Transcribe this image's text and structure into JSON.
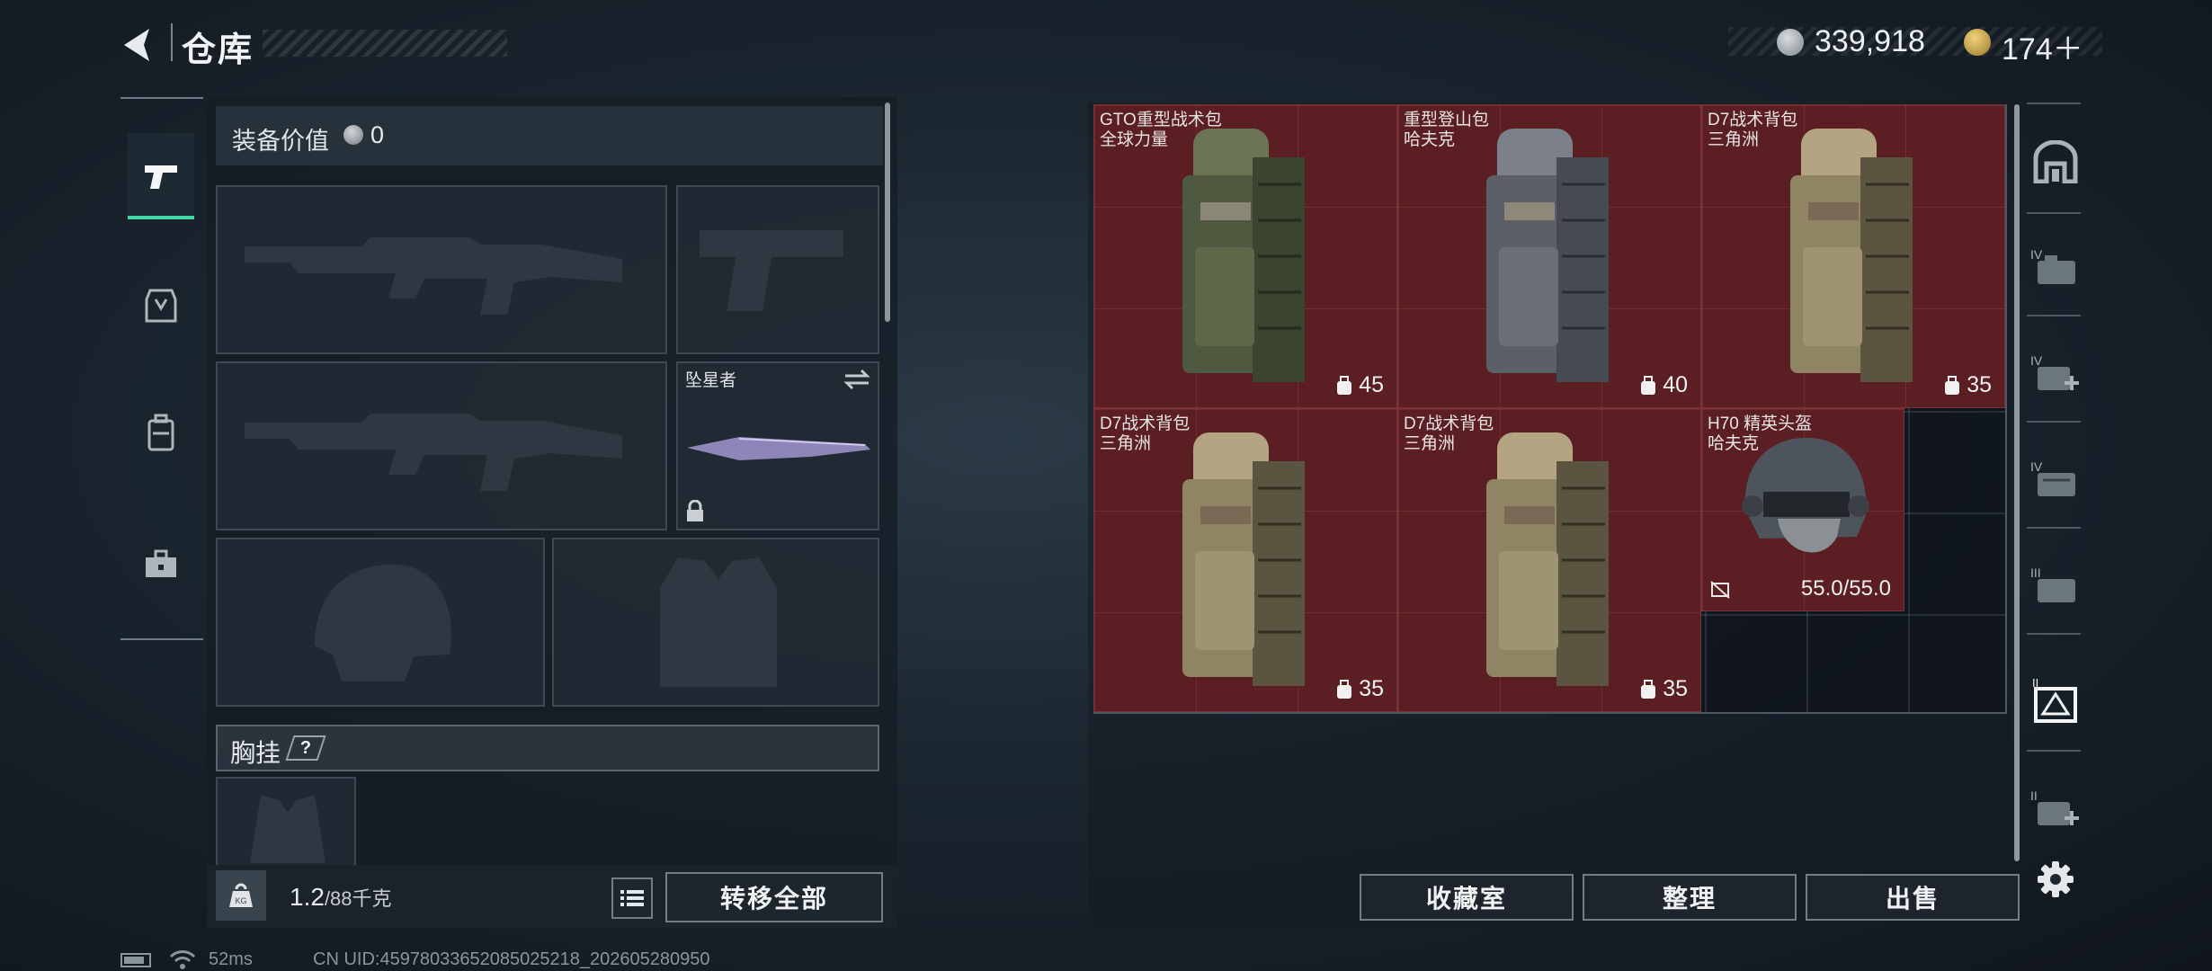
{
  "header": {
    "title": "仓库",
    "currency_primary": "339,918",
    "currency_secondary": "174＋"
  },
  "left_rail": {
    "items": [
      {
        "name": "weapons",
        "icon": "pistol-icon",
        "active": true
      },
      {
        "name": "gear",
        "icon": "helmet-armor-icon",
        "active": false
      },
      {
        "name": "backpack",
        "icon": "backpack-icon",
        "active": false
      },
      {
        "name": "supplies",
        "icon": "toolbox-icon",
        "active": false
      }
    ]
  },
  "equipment": {
    "value_label": "装备价值",
    "value": "0",
    "melee_slot_name": "坠星者",
    "chest_label": "胸挂",
    "chest_help": "?",
    "weight_current": "1.2",
    "weight_max": "/88千克",
    "transfer_all_label": "转移全部"
  },
  "stash": {
    "items": [
      {
        "name": "GTO重型战术包",
        "brand": "全球力量",
        "capacity": "45",
        "icon": "backpack-icon"
      },
      {
        "name": "重型登山包",
        "brand": "哈夫克",
        "capacity": "40",
        "icon": "backpack-icon"
      },
      {
        "name": "D7战术背包",
        "brand": "三角洲",
        "capacity": "35",
        "icon": "backpack-icon"
      },
      {
        "name": "D7战术背包",
        "brand": "三角洲",
        "capacity": "35",
        "icon": "backpack-icon"
      },
      {
        "name": "D7战术背包",
        "brand": "三角洲",
        "capacity": "35",
        "icon": "backpack-icon"
      },
      {
        "name": "H70 精英头盔",
        "brand": "哈夫克",
        "durability": "55.0/55.0",
        "icon": "helmet-icon"
      }
    ],
    "buttons": {
      "collection": "收藏室",
      "sort": "整理",
      "sell": "出售"
    }
  },
  "status_bar": {
    "ping": "52ms",
    "uid": "CN UID:4597803365208502521​8_202605280950"
  },
  "colors": {
    "accent_green": "#41d6a4",
    "item_bg_red": "#5b1e23"
  }
}
